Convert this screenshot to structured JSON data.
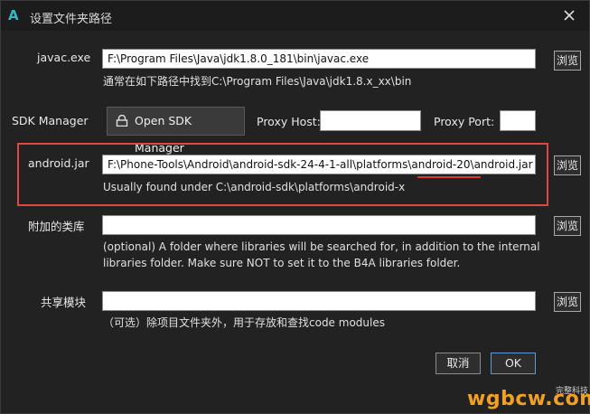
{
  "window": {
    "title": "设置文件夹路径",
    "app_icon_glyph": "A"
  },
  "javac": {
    "label": "javac.exe",
    "value": "F:\\Program Files\\Java\\jdk1.8.0_181\\bin\\javac.exe",
    "hint": "通常在如下路径中找到C:\\Program Files\\Java\\jdk1.8.x_xx\\bin",
    "browse": "浏览"
  },
  "sdk": {
    "label": "SDK Manager",
    "button": "Open SDK Manager",
    "proxy_host_label": "Proxy Host:",
    "proxy_host_value": "",
    "proxy_port_label": "Proxy Port:",
    "proxy_port_value": ""
  },
  "android": {
    "label": "android.jar",
    "value": "F:\\Phone-Tools\\Android\\android-sdk-24-4-1-all\\platforms\\android-20\\android.jar",
    "hint": "Usually found under C:\\android-sdk\\platforms\\android-x",
    "browse": "浏览"
  },
  "libraries": {
    "label": "附加的类库",
    "value": "",
    "hint_line1": "(optional) A folder where libraries will be searched for, in addition to the internal",
    "hint_line2": "libraries folder. Make sure NOT to set it to the B4A libraries folder.",
    "browse": "浏览"
  },
  "shared": {
    "label": "共享模块",
    "value": "",
    "hint": "（可选）除项目文件夹外，用于存放和查找code modules",
    "browse": "浏览"
  },
  "buttons": {
    "cancel": "取消",
    "ok": "OK"
  },
  "watermark": {
    "small": "完整科技",
    "big": "wgbcw.com"
  },
  "colors": {
    "highlight_border": "#e04646",
    "ok_border": "#5a9bd5",
    "app_icon": "#2fb8c8",
    "watermark": "#f2a024"
  }
}
